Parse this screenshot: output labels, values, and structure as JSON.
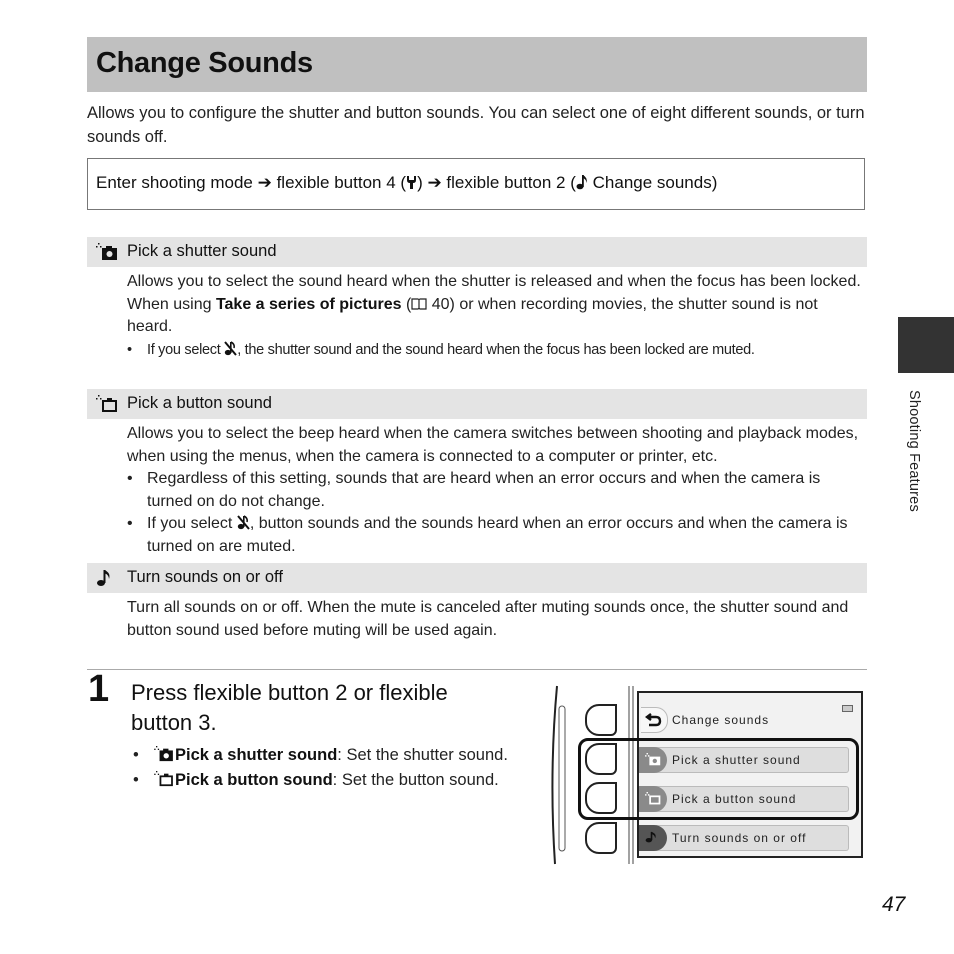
{
  "page": {
    "title": "Change Sounds",
    "intro": "Allows you to configure the shutter and button sounds. You can select one of eight different sounds, or turn sounds off.",
    "path": {
      "part1": "Enter shooting mode ",
      "arrow": "➔",
      "part2": " flexible button 4 (",
      "wrench_icon": "wrench-icon",
      "part3": ") ",
      "part4": " flexible button 2 (",
      "note_icon": "music-note-icon",
      "part5": " Change sounds)"
    },
    "sections": [
      {
        "icon": "shutter-sound-icon",
        "label": "Pick a shutter sound",
        "paragraph1": "Allows you to select the sound heard when the shutter is released and when the focus has been locked.",
        "paragraph2_pre": "When using ",
        "paragraph2_bold": "Take a series of pictures",
        "paragraph2_ref": " (",
        "paragraph2_ref_icon": "book-icon",
        "paragraph2_ref_page": " 40)",
        "paragraph2_post": " or when recording movies, the shutter sound is not heard.",
        "bullet_pre": "If you select ",
        "bullet_icon": "mute-icon",
        "bullet_post": ", the shutter sound and the sound heard when the focus has been locked are muted."
      },
      {
        "icon": "button-sound-icon",
        "label": "Pick a button sound",
        "paragraph1": "Allows you to select the beep heard when the camera switches between shooting and playback modes, when using the menus, when the camera is connected to a computer or printer, etc.",
        "bullet1": "Regardless of this setting, sounds that are heard when an error occurs and when the camera is turned on do not change.",
        "bullet2_pre": "If you select ",
        "bullet2_icon": "mute-icon",
        "bullet2_post": ", button sounds and the sounds heard when an error occurs and when the camera is turned on are muted."
      },
      {
        "icon": "music-note-icon",
        "label": "Turn sounds on or off",
        "paragraph1": "Turn all sounds on or off. When the mute is canceled after muting sounds once, the shutter sound and button sound used before muting will be used again."
      }
    ],
    "step": {
      "number": "1",
      "title": "Press flexible button 2 or flexible button 3.",
      "items": [
        {
          "icon": "shutter-sound-icon",
          "bold": "Pick a shutter sound",
          "text": ": Set the shutter sound."
        },
        {
          "icon": "button-sound-icon",
          "bold": "Pick a button sound",
          "text": ": Set the button sound."
        }
      ]
    },
    "camera_screen": {
      "header": "Change sounds",
      "items": [
        "Pick a shutter sound",
        "Pick a button sound",
        "Turn sounds on or off"
      ],
      "highlighted": [
        "Pick a shutter sound",
        "Pick a button sound"
      ]
    },
    "side_tab": "Shooting Features",
    "page_number": "47"
  }
}
